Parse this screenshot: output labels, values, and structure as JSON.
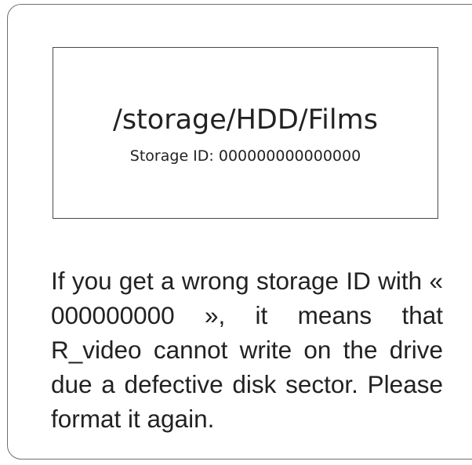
{
  "storage_box": {
    "path": "/storage/HDD/Films",
    "id_line": "Storage ID: 000000000000000"
  },
  "note": {
    "text": "If you get a wrong storage ID with « 000000000 », it means that R_video cannot write on the drive due a defective disk sector. Please format it again."
  }
}
